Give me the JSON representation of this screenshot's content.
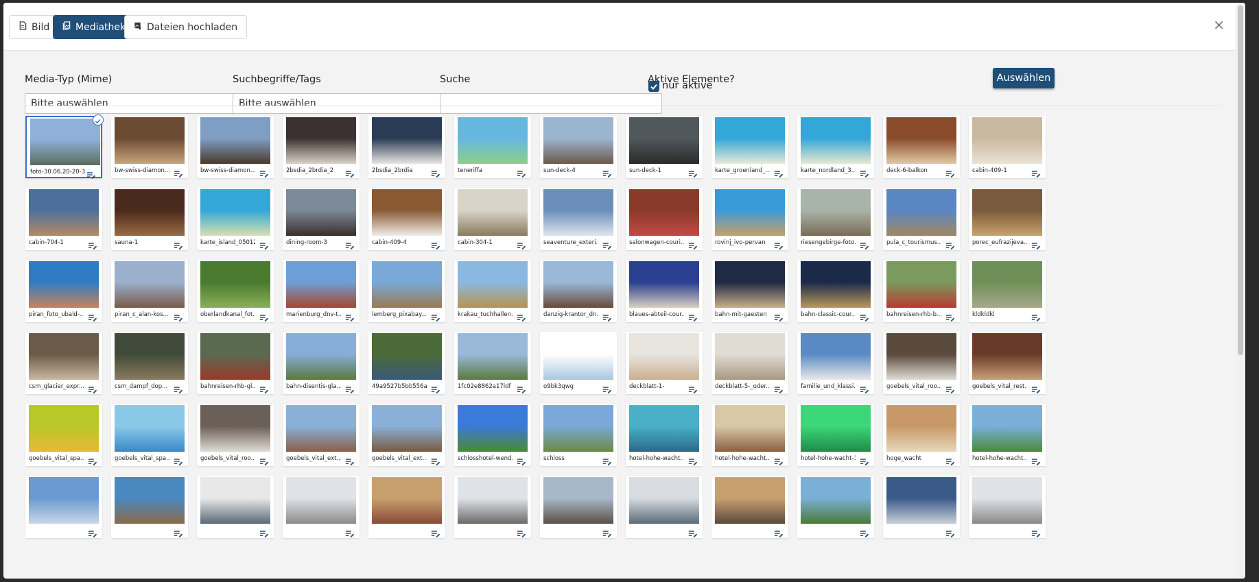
{
  "tabs": [
    {
      "label": "Bild",
      "icon": "file-icon",
      "active": false
    },
    {
      "label": "Mediathek",
      "icon": "media-library-icon",
      "active": true
    },
    {
      "label": "Dateien hochladen",
      "icon": "upload-image-icon",
      "active": false
    }
  ],
  "close_label": "×",
  "filters": {
    "mime_label": "Media-Typ (Mime)",
    "mime_value": "Bitte auswählen",
    "tags_label": "Suchbegriffe/Tags",
    "tags_value": "Bitte auswählen",
    "search_label": "Suche",
    "search_value": "",
    "active_label": "Aktive Elemente?",
    "active_checkbox_label": "nur aktive",
    "active_checked": true
  },
  "select_button": "Auswählen",
  "colors": {
    "accent": "#1f4e79",
    "selected_border": "#3b6fc4"
  },
  "media": [
    {
      "name": "foto-30.06.20-20-3...",
      "c1": "#8fb0d8",
      "c2": "#5a6d5c",
      "selected": true
    },
    {
      "name": "bw-swiss-diamon...",
      "c1": "#6b4a33",
      "c2": "#c9a57c"
    },
    {
      "name": "bw-swiss-diamon...",
      "c1": "#7f9ec4",
      "c2": "#4a3a2c"
    },
    {
      "name": "2bsdia_2brdia_2",
      "c1": "#3b3130",
      "c2": "#d9d2c8"
    },
    {
      "name": "2bsdia_2brdia",
      "c1": "#2a3b55",
      "c2": "#e9e6e1"
    },
    {
      "name": "teneriffa",
      "c1": "#66b7e0",
      "c2": "#8ccf88"
    },
    {
      "name": "sun-deck-4",
      "c1": "#9cb5cf",
      "c2": "#6d5a4c"
    },
    {
      "name": "sun-deck-1",
      "c1": "#50585c",
      "c2": "#2b2a28"
    },
    {
      "name": "karte_groenland_...",
      "c1": "#33a7d8",
      "c2": "#e9e9d8"
    },
    {
      "name": "karte_nordland_3...",
      "c1": "#33a7d8",
      "c2": "#e8e8d0"
    },
    {
      "name": "deck-6-balkon",
      "c1": "#8a4b2c",
      "c2": "#e1c9a3"
    },
    {
      "name": "cabin-409-1",
      "c1": "#c9b9a0",
      "c2": "#eae3d4"
    },
    {
      "name": "cabin-704-1",
      "c1": "#4d6f9c",
      "c2": "#b78a63"
    },
    {
      "name": "sauna-1",
      "c1": "#4a2a1c",
      "c2": "#9b6a43"
    },
    {
      "name": "karte_island_050121",
      "c1": "#33a7d8",
      "c2": "#d8e0b0"
    },
    {
      "name": "dining-room-3",
      "c1": "#7c8a98",
      "c2": "#3b2f2a"
    },
    {
      "name": "cabin-409-4",
      "c1": "#8a5a35",
      "c2": "#f0ede8"
    },
    {
      "name": "cabin-304-1",
      "c1": "#dad4c8",
      "c2": "#8a7a60"
    },
    {
      "name": "seaventure_exteri...",
      "c1": "#6b8fb8",
      "c2": "#dfe6ec"
    },
    {
      "name": "salonwagen-couri...",
      "c1": "#8a3a2a",
      "c2": "#c24a44"
    },
    {
      "name": "rovinj_ivo-pervan",
      "c1": "#3a9ad8",
      "c2": "#c9a068"
    },
    {
      "name": "riesengebirge-foto...",
      "c1": "#a9b4a8",
      "c2": "#7a6b55"
    },
    {
      "name": "pula_c_tourismus...",
      "c1": "#5a86c4",
      "c2": "#a08860"
    },
    {
      "name": "porec_eufrazijeva...",
      "c1": "#7a5a3c",
      "c2": "#c9a46a"
    },
    {
      "name": "piran_foto_ubald-...",
      "c1": "#2f7cc4",
      "c2": "#c9835a"
    },
    {
      "name": "piran_c_alan-kos...",
      "c1": "#9ab0cc",
      "c2": "#7a5a48"
    },
    {
      "name": "oberlandkanal_fot...",
      "c1": "#4a7a30",
      "c2": "#8ab058"
    },
    {
      "name": "marienburg_dnv-t...",
      "c1": "#6f9fd8",
      "c2": "#a8452c"
    },
    {
      "name": "lemberg_pixabay...",
      "c1": "#7aa8d8",
      "c2": "#9a7a50"
    },
    {
      "name": "krakau_tuchhallen...",
      "c1": "#8ab8e0",
      "c2": "#b8944c"
    },
    {
      "name": "danzig-krantor_dn...",
      "c1": "#9ab8d8",
      "c2": "#6a4a38"
    },
    {
      "name": "blaues-abteil-cour...",
      "c1": "#2a3f8f",
      "c2": "#d8d0c0"
    },
    {
      "name": "bahn-mit-gaesten",
      "c1": "#1f2a44",
      "c2": "#c8b088"
    },
    {
      "name": "bahn-classic-cour...",
      "c1": "#1c2a4a",
      "c2": "#b89a5a"
    },
    {
      "name": "bahnreisen-rhb-b...",
      "c1": "#7a9a60",
      "c2": "#b83a30"
    },
    {
      "name": "kldkldkl",
      "c1": "#6f8f58",
      "c2": "#a8a888"
    },
    {
      "name": "csm_glacier_expr...",
      "c1": "#6a5a48",
      "c2": "#c9b8a0"
    },
    {
      "name": "csm_dampf_dop...",
      "c1": "#3f4a38",
      "c2": "#8a7a60"
    },
    {
      "name": "bahnreisen-rhb-gl...",
      "c1": "#5a6a50",
      "c2": "#9a3a2c"
    },
    {
      "name": "bahn-disentis-gla...",
      "c1": "#88aed8",
      "c2": "#5a7a40"
    },
    {
      "name": "49a9527b5bb556a...",
      "c1": "#4a6a38",
      "c2": "#3a5a78"
    },
    {
      "name": "1fc02e8862a17ldf",
      "c1": "#9ab8d8",
      "c2": "#5a7a40"
    },
    {
      "name": "o9bk3qwg",
      "c1": "#ffffff",
      "c2": "#a8c8e0"
    },
    {
      "name": "deckblatt-1-",
      "c1": "#e8e4de",
      "c2": "#c9b090"
    },
    {
      "name": "deckblatt-5-_oder...",
      "c1": "#e0dcd4",
      "c2": "#a89880"
    },
    {
      "name": "familie_und_klassi...",
      "c1": "#5a8ac4",
      "c2": "#e8e8e8"
    },
    {
      "name": "goebels_vital_roo...",
      "c1": "#5a4a3c",
      "c2": "#e0dcd4"
    },
    {
      "name": "goebels_vital_rest...",
      "c1": "#6a3a28",
      "c2": "#c9a07a"
    },
    {
      "name": "goebels_vital_spa...",
      "c1": "#b8c828",
      "c2": "#e8b838"
    },
    {
      "name": "goebels_vital_spa...",
      "c1": "#8ac8e8",
      "c2": "#3a8ac8"
    },
    {
      "name": "goebels_vital_roo...",
      "c1": "#6a6058",
      "c2": "#e0dcd4"
    },
    {
      "name": "goebels_vital_ext...",
      "c1": "#8ab0d8",
      "c2": "#8a6048"
    },
    {
      "name": "goebels_vital_ext...",
      "c1": "#8ab0d8",
      "c2": "#7a5a40"
    },
    {
      "name": "schlosshotel-wend...",
      "c1": "#3a7ad8",
      "c2": "#4a8a30"
    },
    {
      "name": "schloss",
      "c1": "#7aa8d8",
      "c2": "#6a8a40"
    },
    {
      "name": "hotel-hohe-wacht...",
      "c1": "#4ab0c8",
      "c2": "#2a6a8a"
    },
    {
      "name": "hotel-hohe-wacht...",
      "c1": "#d8c8a8",
      "c2": "#8a6040"
    },
    {
      "name": "hotel-hohe-wacht-1",
      "c1": "#3ad878",
      "c2": "#208a48"
    },
    {
      "name": "hoge_wacht",
      "c1": "#c89868",
      "c2": "#e8d8b8"
    },
    {
      "name": "hotel-hohe-wacht...",
      "c1": "#7ab0d8",
      "c2": "#4a8a38"
    },
    {
      "name": "",
      "c1": "#6a9ad0",
      "c2": "#c8d8e8"
    },
    {
      "name": "",
      "c1": "#4a88c0",
      "c2": "#8a6a48"
    },
    {
      "name": "",
      "c1": "#e8e8e8",
      "c2": "#5a6a78"
    },
    {
      "name": "",
      "c1": "#dfe3e8",
      "c2": "#8a8a88"
    },
    {
      "name": "",
      "c1": "#c8a070",
      "c2": "#8a4a38"
    },
    {
      "name": "",
      "c1": "#dfe3e8",
      "c2": "#6a6a68"
    },
    {
      "name": "",
      "c1": "#a8b8c8",
      "c2": "#5a5048"
    },
    {
      "name": "",
      "c1": "#d8dce0",
      "c2": "#5a6a78"
    },
    {
      "name": "",
      "c1": "#c8a070",
      "c2": "#5a4a3a"
    },
    {
      "name": "",
      "c1": "#7ab0d8",
      "c2": "#4a7a38"
    },
    {
      "name": "",
      "c1": "#3a5a8a",
      "c2": "#c8d0d8"
    },
    {
      "name": "",
      "c1": "#dfe3e8",
      "c2": "#8a8888"
    }
  ]
}
